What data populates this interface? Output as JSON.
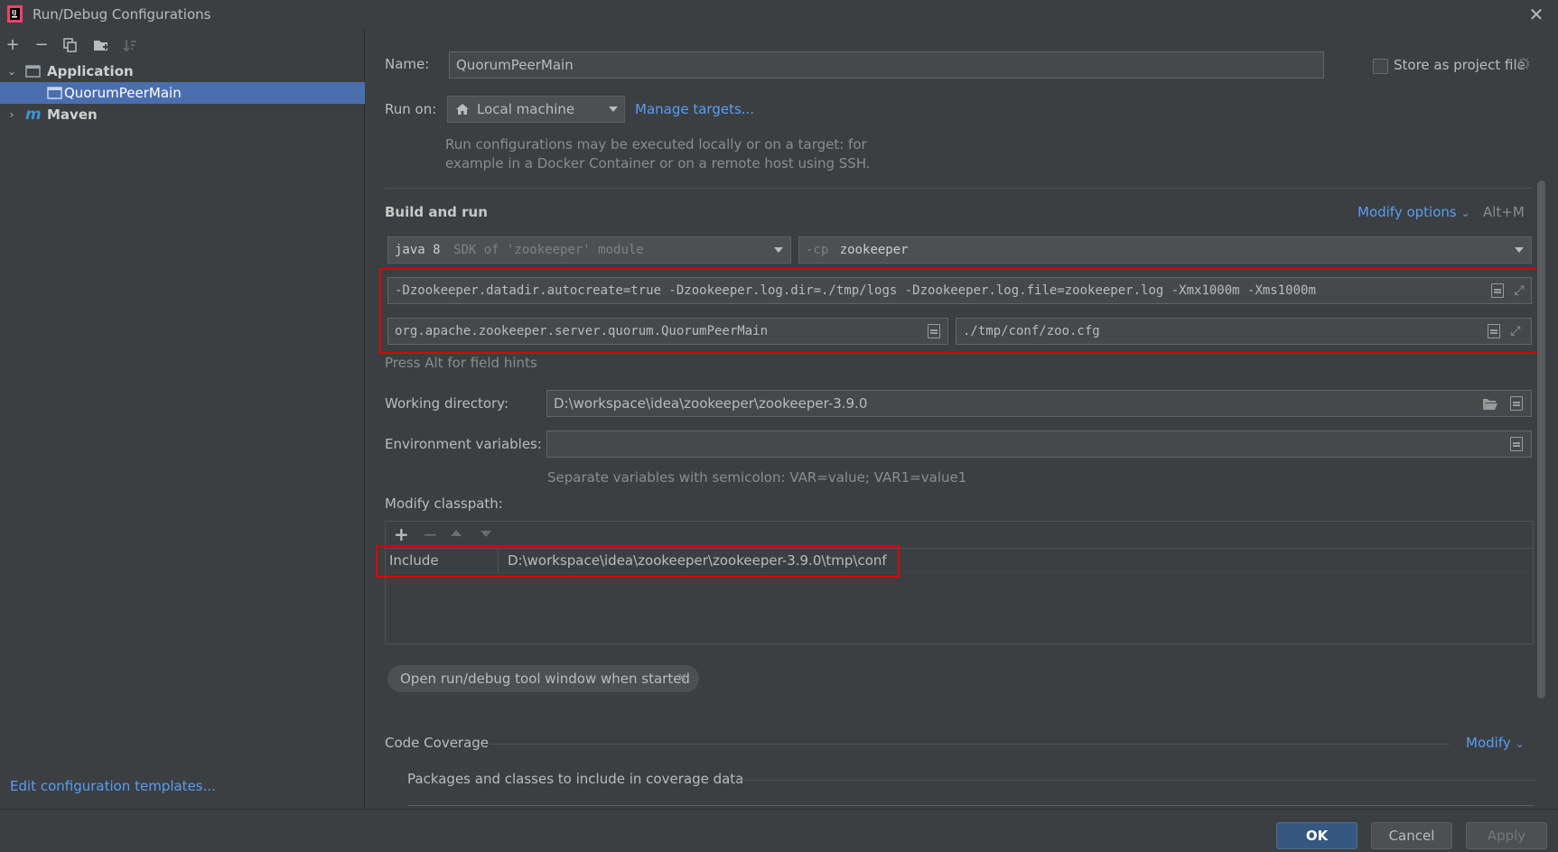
{
  "window": {
    "title": "Run/Debug Configurations"
  },
  "toolbar": {
    "add": "+",
    "remove": "−"
  },
  "tree": {
    "application": "Application",
    "config": "QuorumPeerMain",
    "maven": "Maven"
  },
  "left_footer": {
    "edit_templates": "Edit configuration templates...",
    "help": "?"
  },
  "form": {
    "name_label": "Name:",
    "name_value": "QuorumPeerMain",
    "store_label": "Store as project file",
    "run_on_label": "Run on:",
    "run_on_value": "Local machine",
    "manage_targets": "Manage targets...",
    "run_on_hint_1": "Run configurations may be executed locally or on a target: for",
    "run_on_hint_2": "example in a Docker Container or on a remote host using SSH.",
    "build_run_label": "Build and run",
    "modify_options": "Modify options",
    "modify_shortcut": "Alt+M",
    "jdk_main": "java 8",
    "jdk_hint": "SDK of 'zookeeper' module",
    "cp_prefix": "-cp",
    "cp_value": "zookeeper",
    "vm_options": "-Dzookeeper.datadir.autocreate=true -Dzookeeper.log.dir=./tmp/logs -Dzookeeper.log.file=zookeeper.log -Xmx1000m -Xms1000m",
    "main_class": "org.apache.zookeeper.server.quorum.QuorumPeerMain",
    "program_args": "./tmp/conf/zoo.cfg",
    "alt_hint": "Press Alt for field hints",
    "workdir_label": "Working directory:",
    "workdir_value": "D:\\workspace\\idea\\zookeeper\\zookeeper-3.9.0",
    "env_label": "Environment variables:",
    "env_hint": "Separate variables with semicolon: VAR=value; VAR1=value1",
    "classpath_label": "Modify classpath:",
    "classpath_add": "+",
    "classpath_remove": "−",
    "classpath_row_type": "Include",
    "classpath_row_path": "D:\\workspace\\idea\\zookeeper\\zookeeper-3.9.0\\tmp\\conf",
    "chip_label": "Open run/debug tool window when started",
    "coverage_label": "Code Coverage",
    "coverage_modify": "Modify",
    "coverage_packages": "Packages and classes to include in coverage data"
  },
  "buttons": {
    "ok": "OK",
    "cancel": "Cancel",
    "apply": "Apply"
  },
  "colors": {
    "accent": "#589df6",
    "selection": "#4b6eaf",
    "highlight": "#e00000",
    "primary_button": "#365880"
  }
}
